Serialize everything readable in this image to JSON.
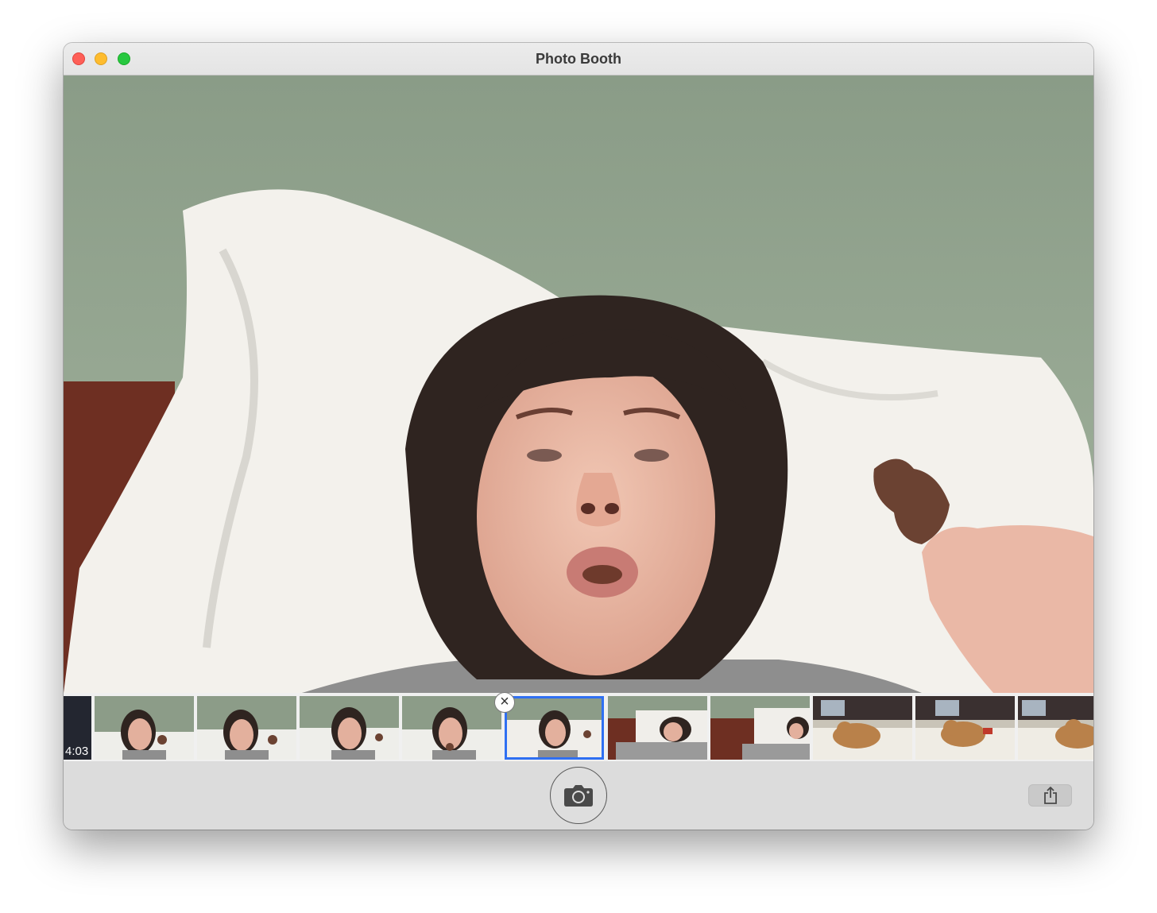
{
  "window": {
    "title": "Photo Booth",
    "controls": [
      "close",
      "minimize",
      "zoom"
    ]
  },
  "camera_preview": {
    "description_icon": "live-camera-feed"
  },
  "filmstrip": {
    "thumbnails": [
      {
        "label": "4:03",
        "kind": "video"
      },
      {
        "label": "",
        "kind": "photo"
      },
      {
        "label": "",
        "kind": "photo"
      },
      {
        "label": "",
        "kind": "photo"
      },
      {
        "label": "",
        "kind": "photo"
      },
      {
        "label": "",
        "kind": "photo",
        "selected": true
      },
      {
        "label": "",
        "kind": "photo"
      },
      {
        "label": "",
        "kind": "photo"
      },
      {
        "label": "",
        "kind": "photo"
      },
      {
        "label": "",
        "kind": "photo"
      },
      {
        "label": "",
        "kind": "photo"
      }
    ],
    "delete_icon": "close-x-icon"
  },
  "toolbar": {
    "shutter_icon": "camera-icon",
    "share_icon": "share-icon"
  },
  "colors": {
    "selection": "#2f6ff2",
    "wall": "#8ea08a",
    "close": "#fe5f57",
    "minimize": "#febc2e",
    "zoom": "#28c840"
  }
}
